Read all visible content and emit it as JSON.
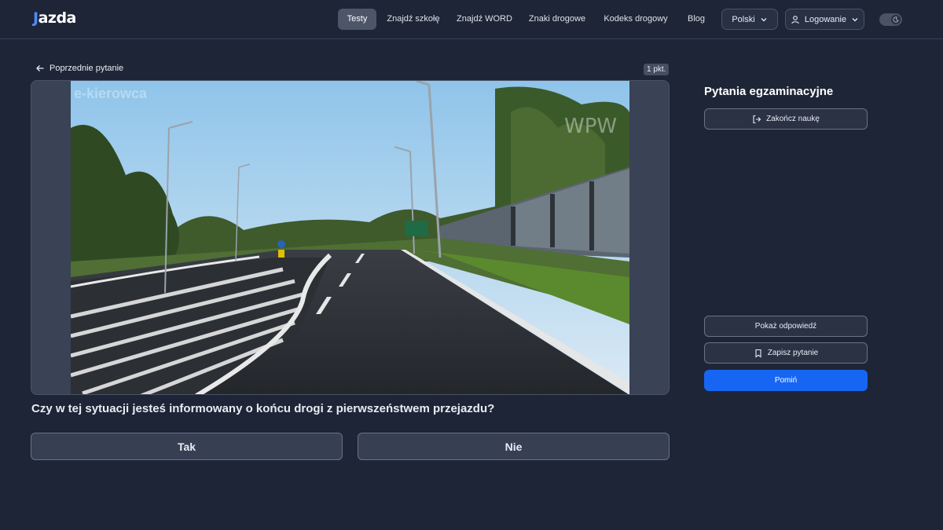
{
  "header": {
    "logo": "jazda",
    "nav": [
      {
        "label": "Testy",
        "active": true
      },
      {
        "label": "Znajdź szkołę",
        "active": false
      },
      {
        "label": "Znajdź WORD",
        "active": false
      },
      {
        "label": "Znaki drogowe",
        "active": false
      },
      {
        "label": "Kodeks drogowy",
        "active": false
      },
      {
        "label": "Blog",
        "active": false
      }
    ],
    "language": "Polski",
    "login": "Logowanie",
    "theme_icon": "moon-icon"
  },
  "main": {
    "prev_label": "Poprzednie pytanie",
    "points": "1 pkt.",
    "video_watermarks": [
      "e-kierowca",
      "WPW"
    ],
    "question": "Czy w tej sytuacji jesteś informowany o końcu drogi z pierwszeństwem przejazdu?",
    "answers": [
      "Tak",
      "Nie"
    ]
  },
  "sidebar": {
    "title": "Pytania egzaminacyjne",
    "end_label": "Zakończ naukę",
    "show_answer_label": "Pokaż odpowiedź",
    "save_label": "Zapisz pytanie",
    "skip_label": "Pomiń"
  },
  "colors": {
    "background": "#1e2536",
    "accent": "#1765f3",
    "logo_accent": "#4d8cff"
  }
}
